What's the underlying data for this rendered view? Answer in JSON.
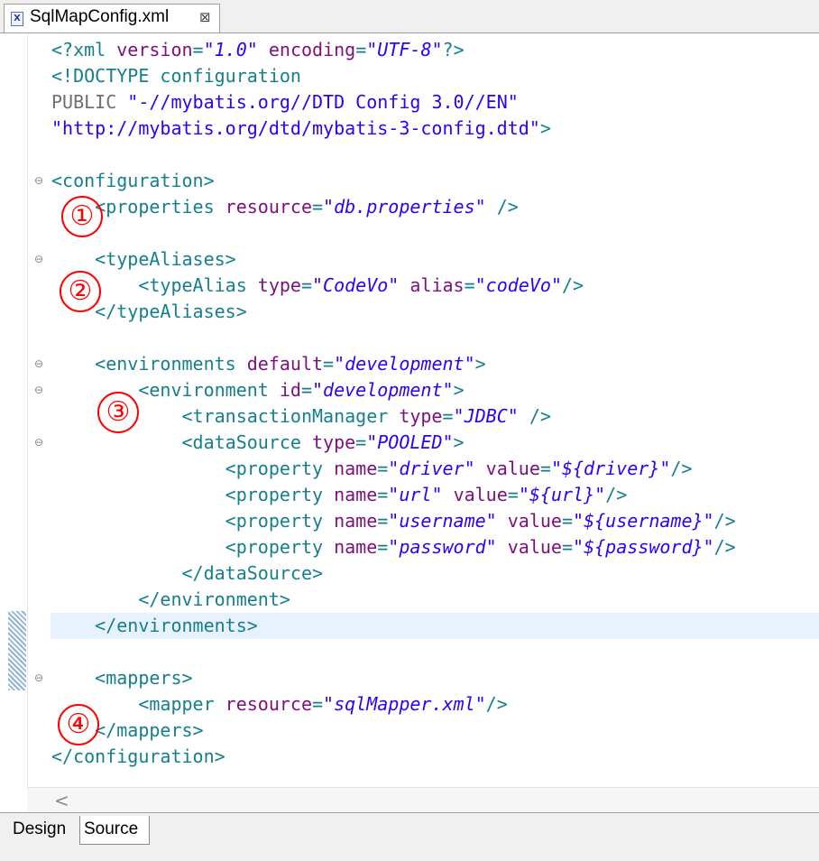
{
  "tab": {
    "title": "SqlMapConfig.xml",
    "icon": "xml-file-icon",
    "close": "⊠"
  },
  "code_lines": [
    [
      [
        "t",
        "<?xml "
      ],
      [
        "a",
        "version"
      ],
      [
        "t",
        "="
      ],
      [
        "v",
        "\"1.0\""
      ],
      [
        "t",
        " "
      ],
      [
        "a",
        "encoding"
      ],
      [
        "t",
        "="
      ],
      [
        "v",
        "\"UTF-8\""
      ],
      [
        "t",
        "?>"
      ]
    ],
    [
      [
        "t",
        "<!DOCTYPE configuration"
      ]
    ],
    [
      [
        "g",
        "PUBLIC "
      ],
      [
        "q",
        "\"-//mybatis.org//DTD Config 3.0//EN\""
      ]
    ],
    [
      [
        "q",
        "\"http://mybatis.org/dtd/mybatis-3-config.dtd\""
      ],
      [
        "t",
        ">"
      ]
    ],
    [],
    [
      [
        "t",
        "<configuration>"
      ]
    ],
    [
      [
        "t",
        "    <properties "
      ],
      [
        "a",
        "resource"
      ],
      [
        "t",
        "="
      ],
      [
        "v",
        "\"db.properties\""
      ],
      [
        "t",
        " />"
      ]
    ],
    [],
    [
      [
        "t",
        "    <typeAliases>"
      ]
    ],
    [
      [
        "t",
        "        <typeAlias "
      ],
      [
        "a",
        "type"
      ],
      [
        "t",
        "="
      ],
      [
        "v",
        "\"CodeVo\""
      ],
      [
        "t",
        " "
      ],
      [
        "a",
        "alias"
      ],
      [
        "t",
        "="
      ],
      [
        "v",
        "\"codeVo\""
      ],
      [
        "t",
        "/>"
      ]
    ],
    [
      [
        "t",
        "    </typeAliases>"
      ]
    ],
    [],
    [
      [
        "t",
        "    <environments "
      ],
      [
        "a",
        "default"
      ],
      [
        "t",
        "="
      ],
      [
        "v",
        "\"development\""
      ],
      [
        "t",
        ">"
      ]
    ],
    [
      [
        "t",
        "        <environment "
      ],
      [
        "a",
        "id"
      ],
      [
        "t",
        "="
      ],
      [
        "v",
        "\"development\""
      ],
      [
        "t",
        ">"
      ]
    ],
    [
      [
        "t",
        "            <transactionManager "
      ],
      [
        "a",
        "type"
      ],
      [
        "t",
        "="
      ],
      [
        "v",
        "\"JDBC\""
      ],
      [
        "t",
        " />"
      ]
    ],
    [
      [
        "t",
        "            <dataSource "
      ],
      [
        "a",
        "type"
      ],
      [
        "t",
        "="
      ],
      [
        "v",
        "\"POOLED\""
      ],
      [
        "t",
        ">"
      ]
    ],
    [
      [
        "t",
        "                <property "
      ],
      [
        "a",
        "name"
      ],
      [
        "t",
        "="
      ],
      [
        "v",
        "\"driver\""
      ],
      [
        "t",
        " "
      ],
      [
        "a",
        "value"
      ],
      [
        "t",
        "="
      ],
      [
        "v",
        "\"${driver}\""
      ],
      [
        "t",
        "/>"
      ]
    ],
    [
      [
        "t",
        "                <property "
      ],
      [
        "a",
        "name"
      ],
      [
        "t",
        "="
      ],
      [
        "v",
        "\"url\""
      ],
      [
        "t",
        " "
      ],
      [
        "a",
        "value"
      ],
      [
        "t",
        "="
      ],
      [
        "v",
        "\"${url}\""
      ],
      [
        "t",
        "/>"
      ]
    ],
    [
      [
        "t",
        "                <property "
      ],
      [
        "a",
        "name"
      ],
      [
        "t",
        "="
      ],
      [
        "v",
        "\"username\""
      ],
      [
        "t",
        " "
      ],
      [
        "a",
        "value"
      ],
      [
        "t",
        "="
      ],
      [
        "v",
        "\"${username}\""
      ],
      [
        "t",
        "/>"
      ]
    ],
    [
      [
        "t",
        "                <property "
      ],
      [
        "a",
        "name"
      ],
      [
        "t",
        "="
      ],
      [
        "v",
        "\"password\""
      ],
      [
        "t",
        " "
      ],
      [
        "a",
        "value"
      ],
      [
        "t",
        "="
      ],
      [
        "v",
        "\"${password}\""
      ],
      [
        "t",
        "/>"
      ]
    ],
    [
      [
        "t",
        "            </dataSource>"
      ]
    ],
    [
      [
        "t",
        "        </environment>"
      ]
    ],
    [
      [
        "t",
        "    </environments>"
      ]
    ],
    [],
    [
      [
        "t",
        "    <mappers>"
      ]
    ],
    [
      [
        "t",
        "        <mapper "
      ],
      [
        "a",
        "resource"
      ],
      [
        "t",
        "="
      ],
      [
        "v",
        "\"sqlMapper.xml\""
      ],
      [
        "t",
        "/>"
      ]
    ],
    [
      [
        "t",
        "    </mappers>"
      ]
    ],
    [
      [
        "t",
        "</configuration>"
      ]
    ]
  ],
  "fold_icon": "⊖",
  "markers": [
    "①",
    "②",
    "③",
    "④"
  ],
  "scroll_arrow": "<",
  "bottom_tabs": {
    "design": "Design",
    "source": "Source"
  },
  "colors": {
    "tag": "#157f8c",
    "attribute": "#7f0f7e",
    "value": "#2a00ff",
    "marker": "#ff0000",
    "current_line": "#e8f2fe"
  }
}
